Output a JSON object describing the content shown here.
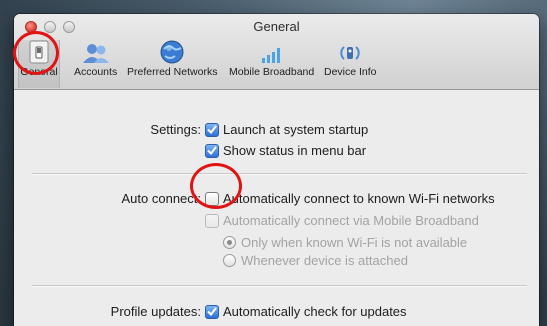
{
  "window": {
    "title": "General"
  },
  "toolbar": {
    "items": [
      {
        "label": "General",
        "icon": "switch-icon"
      },
      {
        "label": "Accounts",
        "icon": "users-icon"
      },
      {
        "label": "Preferred Networks",
        "icon": "globe-icon"
      },
      {
        "label": "Mobile Broadband",
        "icon": "signal-bars-icon"
      },
      {
        "label": "Device Info",
        "icon": "wireless-device-icon"
      }
    ]
  },
  "settings": {
    "label": "Settings:",
    "launch_at_startup": {
      "label": "Launch at system startup",
      "checked": true
    },
    "show_status": {
      "label": "Show status in menu bar",
      "checked": true
    }
  },
  "auto_connect": {
    "label": "Auto connect:",
    "wifi": {
      "label": "Automatically connect to known Wi-Fi networks",
      "checked": false
    },
    "mobile": {
      "label": "Automatically connect via Mobile Broadband",
      "checked": false,
      "enabled": false
    },
    "options": [
      {
        "label": "Only when known Wi-Fi is not available",
        "selected": true
      },
      {
        "label": "Whenever device is attached",
        "selected": false
      }
    ]
  },
  "profile_updates": {
    "label": "Profile updates:",
    "auto_check": {
      "label": "Automatically check for updates",
      "checked": true
    }
  },
  "colors": {
    "accent": "#2e6fd6",
    "annotation": "#e11313",
    "close": "#e0443a"
  }
}
